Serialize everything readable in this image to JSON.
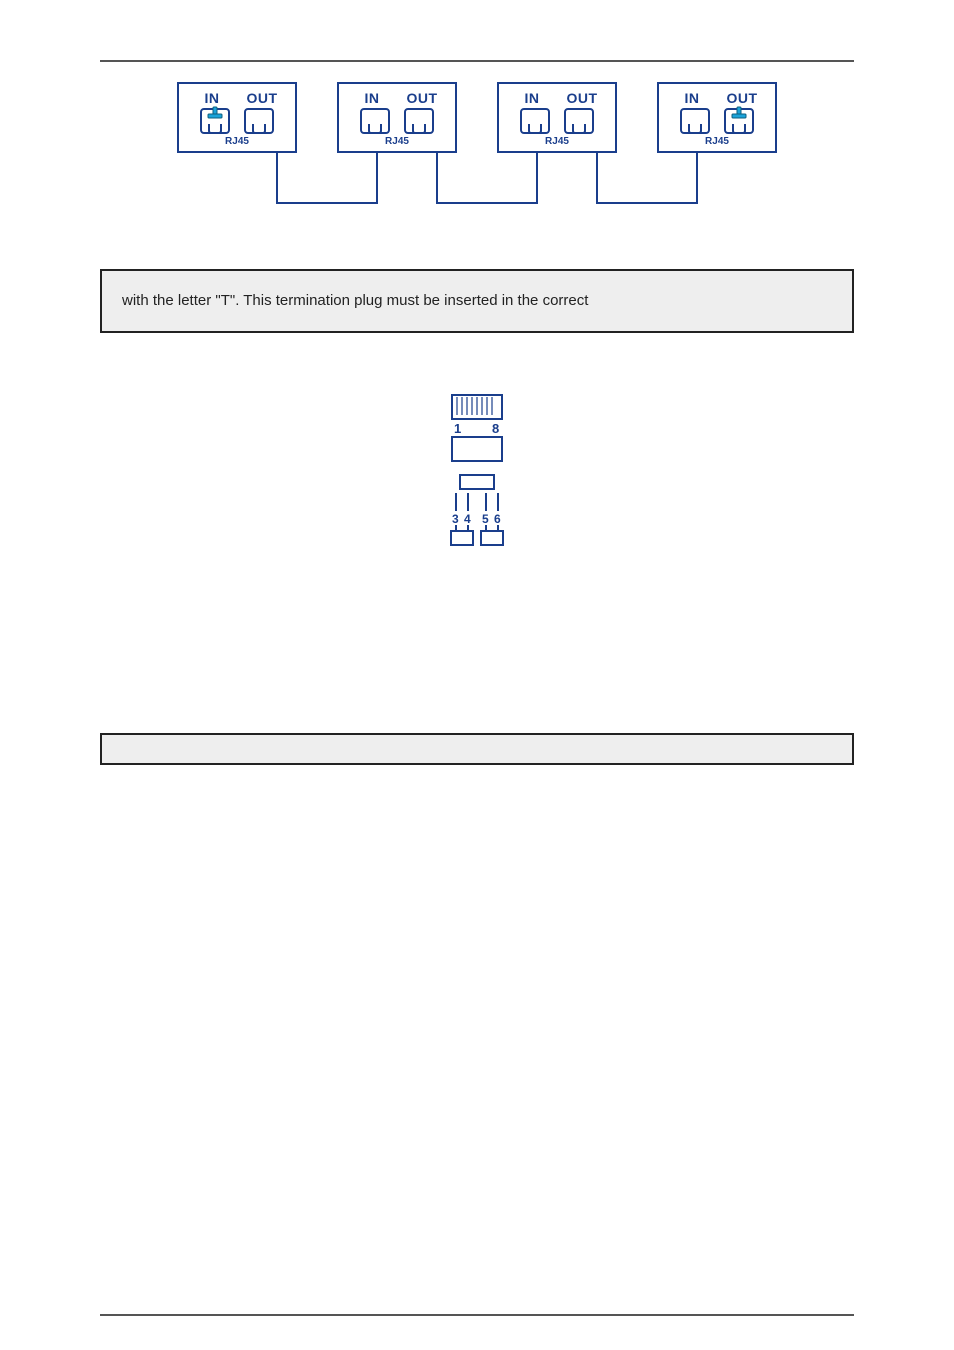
{
  "unit": {
    "in_label": "IN",
    "out_label": "OUT",
    "rj45_label": "RJ45"
  },
  "note": {
    "text": "with the letter \"T\". This termination plug must be inserted in the correct"
  },
  "term_plug": {
    "pin_left": "1",
    "pin_right": "8",
    "res_a1": "3",
    "res_a2": "4",
    "res_b1": "5",
    "res_b2": "6"
  }
}
